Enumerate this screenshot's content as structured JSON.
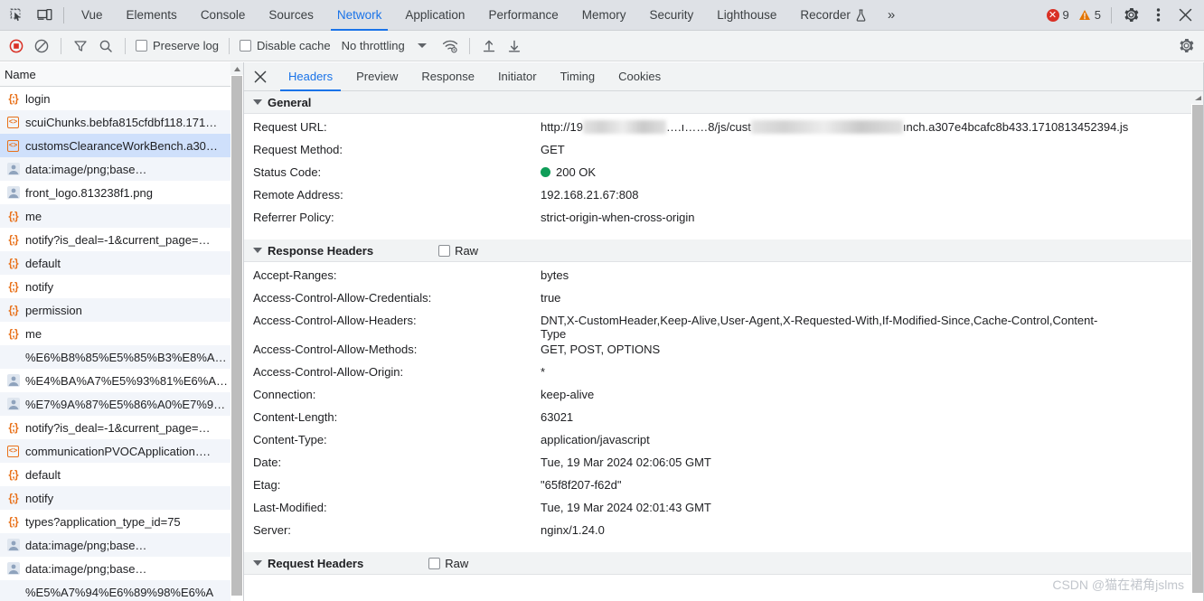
{
  "toolbar": {
    "inspect_icon": "inspect-element-icon",
    "device_icon": "device-toolbar-icon",
    "tabs": [
      {
        "label": "Vue",
        "active": false,
        "flask": false
      },
      {
        "label": "Elements",
        "active": false,
        "flask": false
      },
      {
        "label": "Console",
        "active": false,
        "flask": false
      },
      {
        "label": "Sources",
        "active": false,
        "flask": false
      },
      {
        "label": "Network",
        "active": true,
        "flask": false
      },
      {
        "label": "Application",
        "active": false,
        "flask": false
      },
      {
        "label": "Performance",
        "active": false,
        "flask": false
      },
      {
        "label": "Memory",
        "active": false,
        "flask": false
      },
      {
        "label": "Security",
        "active": false,
        "flask": false
      },
      {
        "label": "Lighthouse",
        "active": false,
        "flask": false
      },
      {
        "label": "Recorder",
        "active": false,
        "flask": true
      }
    ],
    "more_tabs_label": "»",
    "error_count": "9",
    "warning_count": "5",
    "settings_icon": "gear-icon",
    "kebab_icon": "more-options-icon",
    "close_icon": "close-icon",
    "accent_color": "#1a73e8",
    "error_color": "#d93025",
    "warning_color": "#e37400"
  },
  "network_toolbar": {
    "record_icon": "record-stop-icon",
    "clear_icon": "clear-network-log-icon",
    "filter_icon": "filter-icon",
    "search_icon": "search-icon",
    "preserve_log_label": "Preserve log",
    "preserve_log_checked": false,
    "disable_cache_label": "Disable cache",
    "disable_cache_checked": false,
    "throttling_value": "No throttling",
    "wifi_icon": "network-conditions-icon",
    "import_icon": "import-har-icon",
    "export_icon": "export-har-icon",
    "settings_icon": "network-settings-gear-icon"
  },
  "sidebar": {
    "column_header": "Name",
    "scroll_up_icon": "scroll-up-arrow-icon",
    "requests": [
      {
        "name": "login",
        "icon": "json-icon",
        "selected": false
      },
      {
        "name": "scuiChunks.bebfa815cfdbf118.171…",
        "icon": "script-icon",
        "selected": false
      },
      {
        "name": "customsClearanceWorkBench.a30…",
        "icon": "script-icon",
        "selected": true
      },
      {
        "name": "data:image/png;base…",
        "icon": "image-icon",
        "selected": false
      },
      {
        "name": "front_logo.813238f1.png",
        "icon": "image-icon",
        "selected": false
      },
      {
        "name": "me",
        "icon": "json-icon",
        "selected": false
      },
      {
        "name": "notify?is_deal=-1&current_page=…",
        "icon": "json-icon",
        "selected": false
      },
      {
        "name": "default",
        "icon": "json-icon",
        "selected": false
      },
      {
        "name": "notify",
        "icon": "json-icon",
        "selected": false
      },
      {
        "name": "permission",
        "icon": "json-icon",
        "selected": false
      },
      {
        "name": "me",
        "icon": "json-icon",
        "selected": false
      },
      {
        "name": "%E6%B8%85%E5%85%B3%E8%A…",
        "icon": "blank-icon",
        "selected": false
      },
      {
        "name": "%E4%BA%A7%E5%93%81%E6%A…",
        "icon": "image-icon",
        "selected": false
      },
      {
        "name": "%E7%9A%87%E5%86%A0%E7%9…",
        "icon": "image-icon",
        "selected": false
      },
      {
        "name": "notify?is_deal=-1&current_page=…",
        "icon": "json-icon",
        "selected": false
      },
      {
        "name": "communicationPVOCApplication….",
        "icon": "script-icon",
        "selected": false
      },
      {
        "name": "default",
        "icon": "json-icon",
        "selected": false
      },
      {
        "name": "notify",
        "icon": "json-icon",
        "selected": false
      },
      {
        "name": "types?application_type_id=75",
        "icon": "json-icon",
        "selected": false
      },
      {
        "name": "data:image/png;base…",
        "icon": "image-icon",
        "selected": false
      },
      {
        "name": "data:image/png;base…",
        "icon": "image-icon",
        "selected": false
      },
      {
        "name": "%E5%A7%94%E6%89%98%E6%A",
        "icon": "blank-icon",
        "selected": false
      }
    ]
  },
  "detail": {
    "close_icon": "close-panel-icon",
    "tabs": [
      {
        "label": "Headers",
        "active": true
      },
      {
        "label": "Preview",
        "active": false
      },
      {
        "label": "Response",
        "active": false
      },
      {
        "label": "Initiator",
        "active": false
      },
      {
        "label": "Timing",
        "active": false
      },
      {
        "label": "Cookies",
        "active": false
      }
    ],
    "general": {
      "title": "General",
      "rows": [
        {
          "key": "Request URL:",
          "value": "",
          "type": "url"
        },
        {
          "key": "Request Method:",
          "value": "GET",
          "type": "text"
        },
        {
          "key": "Status Code:",
          "value": "200 OK",
          "type": "status"
        },
        {
          "key": "Remote Address:",
          "value": "192.168.21.67:808",
          "type": "text"
        },
        {
          "key": "Referrer Policy:",
          "value": "strict-origin-when-cross-origin",
          "type": "text"
        }
      ],
      "request_url": {
        "prefix": "http://19",
        "redacted_1": "",
        "mid_fragment": "….ı……8/js/cust",
        "redacted_2": "",
        "suffix": "ınch.a307e4bcafc8b433.1710813452394.js"
      }
    },
    "response_headers": {
      "title": "Response Headers",
      "raw_label": "Raw",
      "raw_checked": false,
      "rows": [
        {
          "key": "Accept-Ranges:",
          "value": "bytes"
        },
        {
          "key": "Access-Control-Allow-Credentials:",
          "value": "true"
        },
        {
          "key": "Access-Control-Allow-Headers:",
          "value": "DNT,X-CustomHeader,Keep-Alive,User-Agent,X-Requested-With,If-Modified-Since,Cache-Control,Content-Type"
        },
        {
          "key": "Access-Control-Allow-Methods:",
          "value": "GET, POST, OPTIONS"
        },
        {
          "key": "Access-Control-Allow-Origin:",
          "value": "*"
        },
        {
          "key": "Connection:",
          "value": "keep-alive"
        },
        {
          "key": "Content-Length:",
          "value": "63021"
        },
        {
          "key": "Content-Type:",
          "value": "application/javascript"
        },
        {
          "key": "Date:",
          "value": "Tue, 19 Mar 2024 02:06:05 GMT"
        },
        {
          "key": "Etag:",
          "value": "\"65f8f207-f62d\""
        },
        {
          "key": "Last-Modified:",
          "value": "Tue, 19 Mar 2024 02:01:43 GMT"
        },
        {
          "key": "Server:",
          "value": "nginx/1.24.0"
        }
      ]
    },
    "request_headers": {
      "title": "Request Headers",
      "raw_label": "Raw",
      "raw_checked": false
    },
    "scroll_up_icon": "scroll-up-arrow-icon"
  },
  "watermark": {
    "text": "CSDN @猫在裙角jslms"
  }
}
